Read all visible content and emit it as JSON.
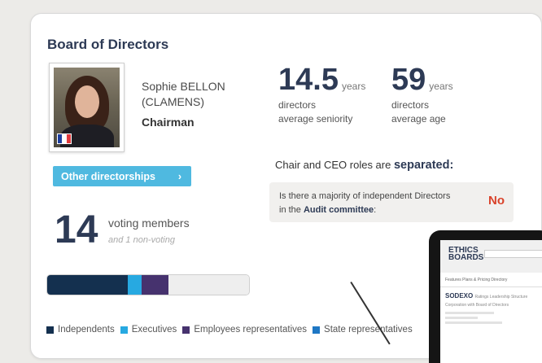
{
  "board": {
    "title": "Board of Directors",
    "director": {
      "name": "Sophie BELLON (CLAMENS)",
      "role": "Chairman",
      "flag_colors": [
        "#1d3e9e",
        "#ffffff",
        "#e03a3e"
      ]
    },
    "other_button": {
      "label": "Other directorships",
      "icon": "chevron-right-icon",
      "arrow": "›"
    },
    "seniority": {
      "value": "14.5",
      "unit": "years",
      "label_line1": "directors",
      "label_line2": "average seniority"
    },
    "age": {
      "value": "59",
      "unit": "years",
      "label_line1": "directors",
      "label_line2": "average age"
    },
    "chair_ceo": {
      "text": "Chair and CEO roles are",
      "emphasis": "separated:"
    },
    "audit": {
      "question_part1": "Is there a majority of independent Directors in the",
      "question_bold": "Audit committee",
      "question_end": ":",
      "answer": "No"
    },
    "voting": {
      "count": "14",
      "label": "voting members",
      "non_voting": "and 1 non-voting"
    },
    "composition": [
      {
        "name": "Independents",
        "count": 6,
        "color": "#14304f"
      },
      {
        "name": "Executives",
        "count": 1,
        "color": "#27a9e1"
      },
      {
        "name": "Employees representatives",
        "count": 2,
        "color": "#46326e"
      },
      {
        "name": "State representatives",
        "count": 0,
        "color": "#1f77c4"
      }
    ],
    "composition_empty_color": "#eeeeee",
    "legend": {
      "independents": "Independents",
      "executives": "Executives",
      "employees": "Employees representatives",
      "state": "State representatives"
    }
  },
  "tablet": {
    "logo_line1": "ETHICS",
    "logo_line2": "BOARDS",
    "nav": "Features  Plans & Pricing  Directory",
    "company": "SODEXO",
    "company_tabs": "Ratings  Leadership Structure",
    "section": "Corporation with Board of Directors"
  }
}
